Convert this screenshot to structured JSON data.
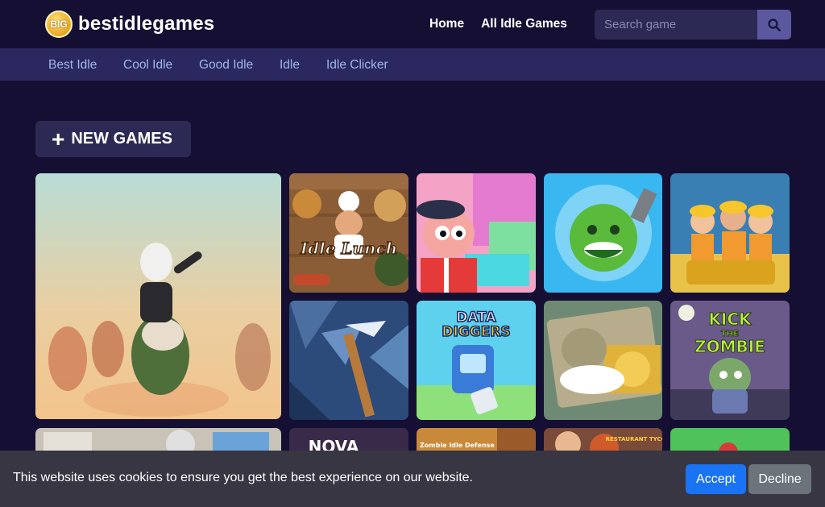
{
  "header": {
    "logo_badge": "BIG",
    "logo_text": "bestidlegames",
    "nav": [
      {
        "label": "Home"
      },
      {
        "label": "All Idle Games"
      }
    ],
    "search_placeholder": "Search game"
  },
  "categories": [
    {
      "label": "Best Idle"
    },
    {
      "label": "Cool Idle"
    },
    {
      "label": "Good Idle"
    },
    {
      "label": "Idle"
    },
    {
      "label": "Idle Clicker"
    }
  ],
  "section": {
    "title": "NEW GAMES",
    "icon": "plus-icon"
  },
  "games": [
    {
      "title": "",
      "art_text": ""
    },
    {
      "title": "Idle Lunch",
      "art_text": "Idle Lunch"
    },
    {
      "title": "",
      "art_text": ""
    },
    {
      "title": "",
      "art_text": ""
    },
    {
      "title": "",
      "art_text": ""
    },
    {
      "title": "",
      "art_text": ""
    },
    {
      "title": "Data Diggers",
      "art_text": "DATA DIGGERS"
    },
    {
      "title": "",
      "art_text": ""
    },
    {
      "title": "Kick the Zombie",
      "art_text": "KICK THE ZOMBIE"
    },
    {
      "title": "",
      "art_text": ""
    },
    {
      "title": "Nova",
      "art_text": "NOVA"
    },
    {
      "title": "Zombie Idle Defense",
      "art_text": "Zombie Idle Defense"
    },
    {
      "title": "",
      "art_text": "RESTAURANT TYCOON"
    },
    {
      "title": "",
      "art_text": ""
    }
  ],
  "cookie": {
    "message": "This website uses cookies to ensure you get the best experience on our website.",
    "accept_label": "Accept",
    "decline_label": "Decline"
  },
  "colors": {
    "background": "#140f33",
    "category_bar": "#2b2860",
    "accent": "#1a73f2"
  }
}
